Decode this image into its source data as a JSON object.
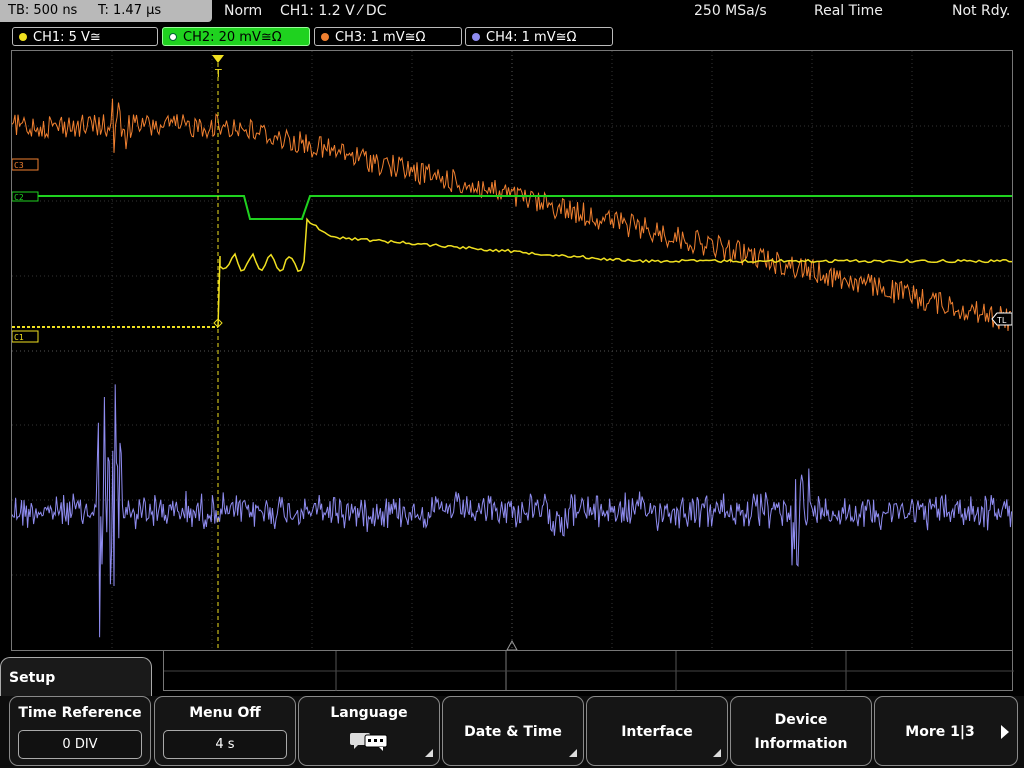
{
  "topbar": {
    "timebase": "TB: 500 ns",
    "trigger_time": "T: 1.47 µs",
    "mode": "Norm",
    "trigger_info": "CH1: 1.2 V ⁄ DC",
    "sample_rate": "250 MSa/s",
    "acq_mode": "Real Time",
    "status": "Not Rdy."
  },
  "channels": [
    {
      "label": "CH1: 5 V≅",
      "color": "#f0e020"
    },
    {
      "label": "CH2: 20 mV≅Ω",
      "color": "#1fd21f"
    },
    {
      "label": "CH3: 1 mV≅Ω",
      "color": "#f08030"
    },
    {
      "label": "CH4: 1 mV≅Ω",
      "color": "#8f8cf0"
    }
  ],
  "markers": {
    "c3": "C3",
    "c2": "C2",
    "c1": "C1",
    "tl": "TL",
    "trigger": "T"
  },
  "menu": {
    "title": "Setup",
    "softkeys": [
      {
        "label": "Time Reference",
        "value": "0 DIV"
      },
      {
        "label": "Menu Off",
        "value": "4 s"
      },
      {
        "label": "Language",
        "icon": "speech-bubbles-icon"
      },
      {
        "label": "Date & Time"
      },
      {
        "label": "Interface"
      },
      {
        "label_line1": "Device",
        "label_line2": "Information"
      },
      {
        "label": "More 1|3"
      }
    ]
  }
}
